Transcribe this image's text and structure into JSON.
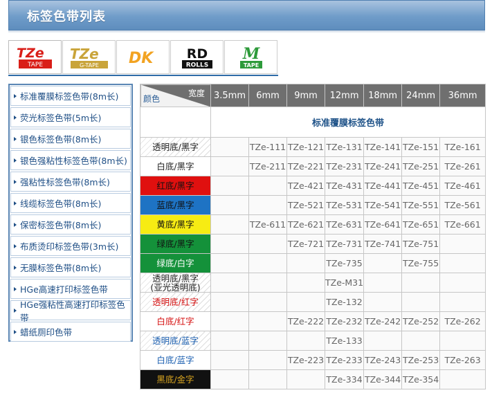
{
  "header": {
    "title": "标签色带列表"
  },
  "brand_tabs": [
    {
      "name": "tze-tape",
      "label": "TZe",
      "sub": "TAPE"
    },
    {
      "name": "tze-gtape",
      "label": "TZe",
      "sub": "G-TAPE"
    },
    {
      "name": "dk",
      "label": "DK",
      "sub": ""
    },
    {
      "name": "rd-rolls",
      "label": "RD",
      "sub": "ROLLS"
    },
    {
      "name": "m-tape",
      "label": "M",
      "sub": "TAPE"
    }
  ],
  "sidebar": {
    "items": [
      "标准覆膜标签色带(8m长)",
      "荧光标签色带(5m长)",
      "银色标签色带(8m长)",
      "银色强粘性标签色带(8m长)",
      "强粘性标签色带(8m长)",
      "线缆标签色带(8m长)",
      "保密标签色带(8m长)",
      "布质烫印标签色带(3m长)",
      "无膜标签色带(8m长)",
      "HGe高速打印标签色带",
      "HGe强粘性高速打印标签色带",
      "蜡纸厕印色带"
    ]
  },
  "table": {
    "corner_width": "宽度",
    "corner_color": "颜色",
    "widths": [
      "3.5mm",
      "6mm",
      "9mm",
      "12mm",
      "18mm",
      "24mm",
      "36mm"
    ],
    "section_title": "标准覆膜标签色带",
    "rows": [
      {
        "label": "透明底/黑字",
        "bg": "#ffffff",
        "fg": "#222222",
        "hatch": true,
        "cells": [
          "",
          "TZe-111",
          "TZe-121",
          "TZe-131",
          "TZe-141",
          "TZe-151",
          "TZe-161"
        ]
      },
      {
        "label": "白底/黑字",
        "bg": "#ffffff",
        "fg": "#222222",
        "hatch": false,
        "cells": [
          "",
          "TZe-211",
          "TZe-221",
          "TZe-231",
          "TZe-241",
          "TZe-251",
          "TZe-261"
        ]
      },
      {
        "label": "红底/黑字",
        "bg": "#e0100f",
        "fg": "#111111",
        "hatch": false,
        "cells": [
          "",
          "",
          "TZe-421",
          "TZe-431",
          "TZe-441",
          "TZe-451",
          "TZe-461"
        ]
      },
      {
        "label": "蓝底/黑字",
        "bg": "#1e73c4",
        "fg": "#111111",
        "hatch": false,
        "cells": [
          "",
          "",
          "TZe-521",
          "TZe-531",
          "TZe-541",
          "TZe-551",
          "TZe-561"
        ]
      },
      {
        "label": "黄底/黑字",
        "bg": "#f7ec13",
        "fg": "#111111",
        "hatch": false,
        "cells": [
          "",
          "TZe-611",
          "TZe-621",
          "TZe-631",
          "TZe-641",
          "TZe-651",
          "TZe-661"
        ]
      },
      {
        "label": "绿底/黑字",
        "bg": "#14913a",
        "fg": "#111111",
        "hatch": false,
        "cells": [
          "",
          "",
          "TZe-721",
          "TZe-731",
          "TZe-741",
          "TZe-751",
          ""
        ]
      },
      {
        "label": "绿底/白字",
        "bg": "#14913a",
        "fg": "#ffffff",
        "hatch": false,
        "cells": [
          "",
          "",
          "",
          "TZe-735",
          "",
          "TZe-755",
          ""
        ]
      },
      {
        "label": "透明底/黑字\n(亚光透明底)",
        "bg": "#ffffff",
        "fg": "#222222",
        "hatch": true,
        "cells": [
          "",
          "",
          "",
          "TZe-M31",
          "",
          "",
          ""
        ]
      },
      {
        "label": "透明底/红字",
        "bg": "#ffffff",
        "fg": "#d51010",
        "hatch": true,
        "cells": [
          "",
          "",
          "",
          "TZe-132",
          "",
          "",
          ""
        ]
      },
      {
        "label": "白底/红字",
        "bg": "#ffffff",
        "fg": "#d51010",
        "hatch": false,
        "cells": [
          "",
          "",
          "TZe-222",
          "TZe-232",
          "TZe-242",
          "TZe-252",
          "TZe-262"
        ]
      },
      {
        "label": "透明底/蓝字",
        "bg": "#ffffff",
        "fg": "#1b5fb0",
        "hatch": true,
        "cells": [
          "",
          "",
          "",
          "TZe-133",
          "",
          "",
          ""
        ]
      },
      {
        "label": "白底/蓝字",
        "bg": "#ffffff",
        "fg": "#1b5fb0",
        "hatch": false,
        "cells": [
          "",
          "",
          "TZe-223",
          "TZe-233",
          "TZe-243",
          "TZe-253",
          "TZe-263"
        ]
      },
      {
        "label": "黑底/金字",
        "bg": "#111111",
        "fg": "#d9a520",
        "hatch": false,
        "cells": [
          "",
          "",
          "",
          "TZe-334",
          "TZe-344",
          "TZe-354",
          ""
        ]
      }
    ]
  }
}
